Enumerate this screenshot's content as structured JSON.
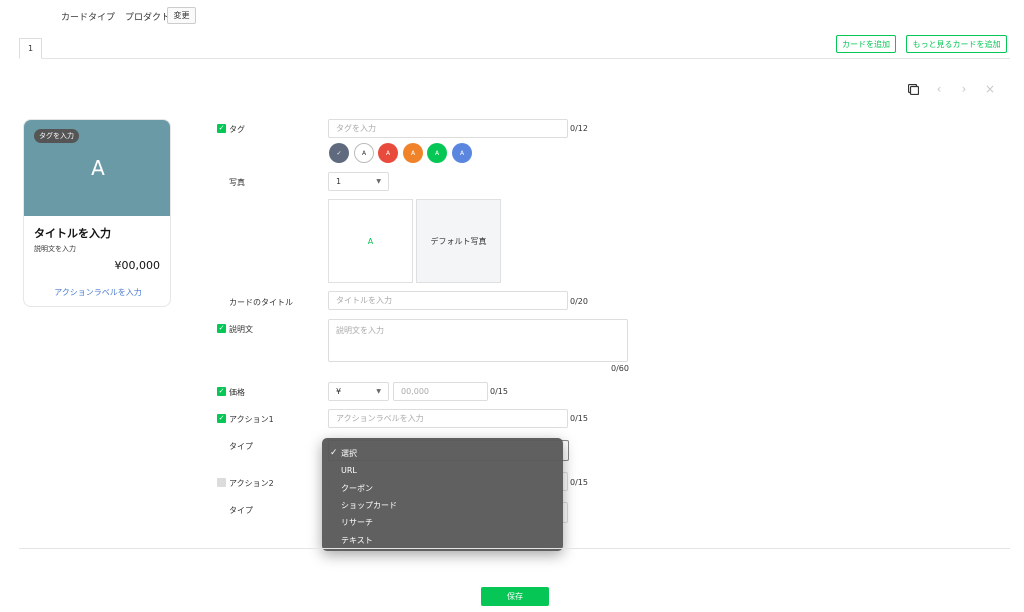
{
  "topbar": {
    "card_type_label": "カードタイプ",
    "card_type_value": "プロダクト",
    "change_label": "変更"
  },
  "tabs": [
    {
      "label": "1"
    }
  ],
  "header_actions": {
    "add_card": "カードを追加",
    "add_more_card": "もっと見るカードを追加"
  },
  "toolbar_icons": [
    "copy-icon",
    "chevron-left-icon",
    "chevron-right-icon",
    "close-icon"
  ],
  "preview": {
    "tag": "タグを入力",
    "image_letter": "A",
    "title": "タイトルを入力",
    "description": "説明文を入力",
    "price": "¥00,000",
    "action_label": "アクションラベルを入力",
    "image_color": "#6b9aa7"
  },
  "form": {
    "tag": {
      "label": "タグ",
      "placeholder": "タグを入力",
      "counter": "0/12"
    },
    "tag_colors": [
      {
        "text": "✓",
        "color": "#5f6a7e"
      },
      {
        "text": "A",
        "color": "#ffffff"
      },
      {
        "text": "A",
        "color": "#e84a3c"
      },
      {
        "text": "A",
        "color": "#f0832a"
      },
      {
        "text": "A",
        "color": "#06c755"
      },
      {
        "text": "A",
        "color": "#5a86e0"
      }
    ],
    "photo": {
      "label": "写真",
      "count": "1",
      "slot_a": "A",
      "default_photo": "デフォルト写真"
    },
    "card_title": {
      "label": "カードのタイトル",
      "placeholder": "タイトルを入力",
      "counter": "0/20"
    },
    "description": {
      "label": "説明文",
      "placeholder": "説明文を入力",
      "counter": "0/60"
    },
    "price": {
      "label": "価格",
      "currency": "¥",
      "placeholder": "00,000",
      "counter": "0/15"
    },
    "action1": {
      "label": "アクション1",
      "placeholder": "アクションラベルを入力",
      "counter": "0/15",
      "type_label": "タイプ"
    },
    "action2": {
      "label": "アクション2",
      "counter": "0/15",
      "type_label": "タイプ"
    }
  },
  "type_dropdown": {
    "selected": "選択",
    "options": [
      "選択",
      "URL",
      "クーポン",
      "ショップカード",
      "リサーチ",
      "テキスト"
    ]
  },
  "save_label": "保存",
  "colors": {
    "accent": "#06c755",
    "link": "#4a7ccf"
  }
}
